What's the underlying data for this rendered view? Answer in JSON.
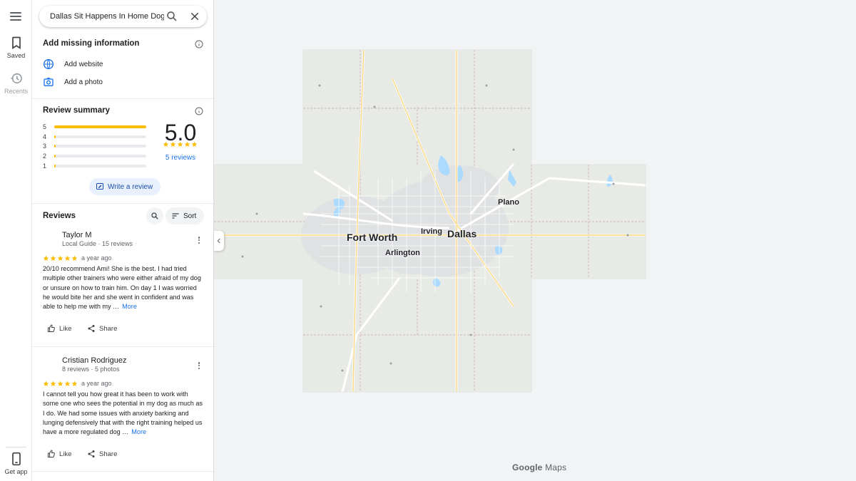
{
  "search": {
    "value": "Dallas Sit Happens In Home Dog Tra"
  },
  "rail": {
    "saved_label": "Saved",
    "recents_label": "Recents",
    "get_app_label": "Get app"
  },
  "missing_info": {
    "title": "Add missing information",
    "add_website": "Add website",
    "add_photo": "Add a photo"
  },
  "review_summary": {
    "title": "Review summary",
    "rating": "5.0",
    "rating_stars": 5,
    "reviews_link": "5 reviews",
    "distribution": [
      {
        "star": "5",
        "fraction": 1.0
      },
      {
        "star": "4",
        "fraction": 0.01
      },
      {
        "star": "3",
        "fraction": 0.01
      },
      {
        "star": "2",
        "fraction": 0.01
      },
      {
        "star": "1",
        "fraction": 0.01
      }
    ],
    "write_review_label": "Write a review"
  },
  "reviews": {
    "title": "Reviews",
    "sort_label": "Sort",
    "items": [
      {
        "name": "Taylor M",
        "meta": "Local Guide · 15 reviews",
        "stars": 5,
        "when": "a year ago",
        "text": "20/10 recommend Ami! She is the best. I had tried multiple other trainers who were either afraid of my dog or unsure on how to train him. On day 1 I was worried he would bite her and she went in confident and was able to help me with my …",
        "more": "More",
        "like": "Like",
        "share": "Share"
      },
      {
        "name": "Cristian Rodriguez",
        "meta": "8 reviews · 5 photos",
        "stars": 5,
        "when": "a year ago",
        "text": "I cannot tell you how great it has been to work with some one who sees the potential in my dog as much as I do. We had some issues with anxiety barking and lunging defensively that with the right training helped us have a more regulated dog …",
        "more": "More",
        "like": "Like",
        "share": "Share"
      }
    ]
  },
  "map": {
    "cities": [
      {
        "name": "Fort Worth",
        "size": "large"
      },
      {
        "name": "Dallas",
        "size": "large"
      },
      {
        "name": "Arlington",
        "size": "medium"
      },
      {
        "name": "Irving",
        "size": "medium"
      },
      {
        "name": "Plano",
        "size": "medium"
      }
    ],
    "logo_brand": "Google",
    "logo_product": "Maps"
  },
  "colors": {
    "accent": "#1a73e8",
    "star": "#fbbc04",
    "tile": "#e8eae6",
    "water": "#aadaff"
  }
}
